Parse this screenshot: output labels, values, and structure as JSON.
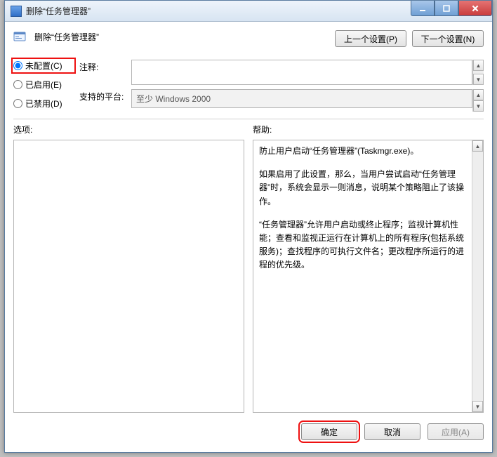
{
  "window": {
    "title": "删除“任务管理器”"
  },
  "header": {
    "policy_title": "删除“任务管理器”",
    "prev": "上一个设置(P)",
    "next": "下一个设置(N)"
  },
  "radios": {
    "not_configured": "未配置(C)",
    "enabled": "已启用(E)",
    "disabled": "已禁用(D)"
  },
  "fields": {
    "comment_label": "注释:",
    "comment_value": "",
    "platform_label": "支持的平台:",
    "platform_value": "至少 Windows 2000"
  },
  "labels": {
    "options": "选项:",
    "help": "帮助:"
  },
  "help": {
    "p1": "防止用户启动“任务管理器”(Taskmgr.exe)。",
    "p2": "如果启用了此设置，那么，当用户尝试启动“任务管理器”时，系统会显示一则消息，说明某个策略阻止了该操作。",
    "p3": "“任务管理器”允许用户启动或终止程序；监视计算机性能；查看和监视正运行在计算机上的所有程序(包括系统服务)；查找程序的可执行文件名；更改程序所运行的进程的优先级。"
  },
  "buttons": {
    "ok": "确定",
    "cancel": "取消",
    "apply": "应用(A)"
  }
}
